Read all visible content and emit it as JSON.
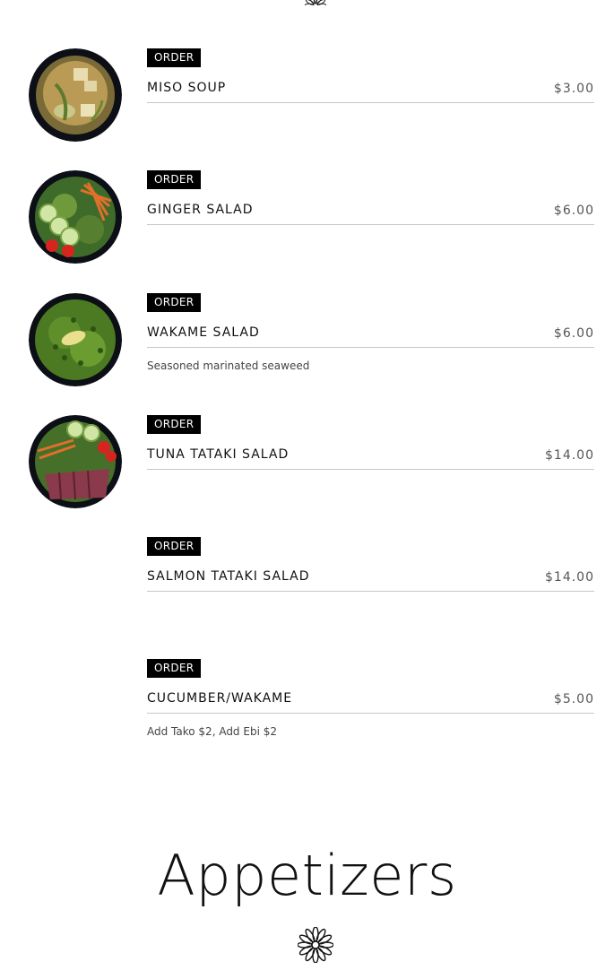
{
  "menu": {
    "order_label": "ORDER",
    "items": [
      {
        "name": "MISO SOUP",
        "price": "$3.00",
        "description": "",
        "image": "miso-soup"
      },
      {
        "name": "GINGER SALAD",
        "price": "$6.00",
        "description": "",
        "image": "ginger-salad"
      },
      {
        "name": "WAKAME SALAD",
        "price": "$6.00",
        "description": "Seasoned marinated seaweed",
        "image": "wakame-salad"
      },
      {
        "name": "TUNA TATAKI SALAD",
        "price": "$14.00",
        "description": "",
        "image": "tuna-tataki-salad"
      },
      {
        "name": "SALMON TATAKI SALAD",
        "price": "$14.00",
        "description": "",
        "image": ""
      },
      {
        "name": "CUCUMBER/WAKAME",
        "price": "$5.00",
        "description": "Add Tako $2, Add Ebi $2",
        "image": ""
      }
    ]
  },
  "next_section": {
    "title": "Appetizers",
    "divider_icon": "flower-icon"
  },
  "colors": {
    "button_bg": "#000000",
    "button_text": "#ffffff",
    "divider": "#c8c8c8",
    "price_text": "#555555"
  }
}
